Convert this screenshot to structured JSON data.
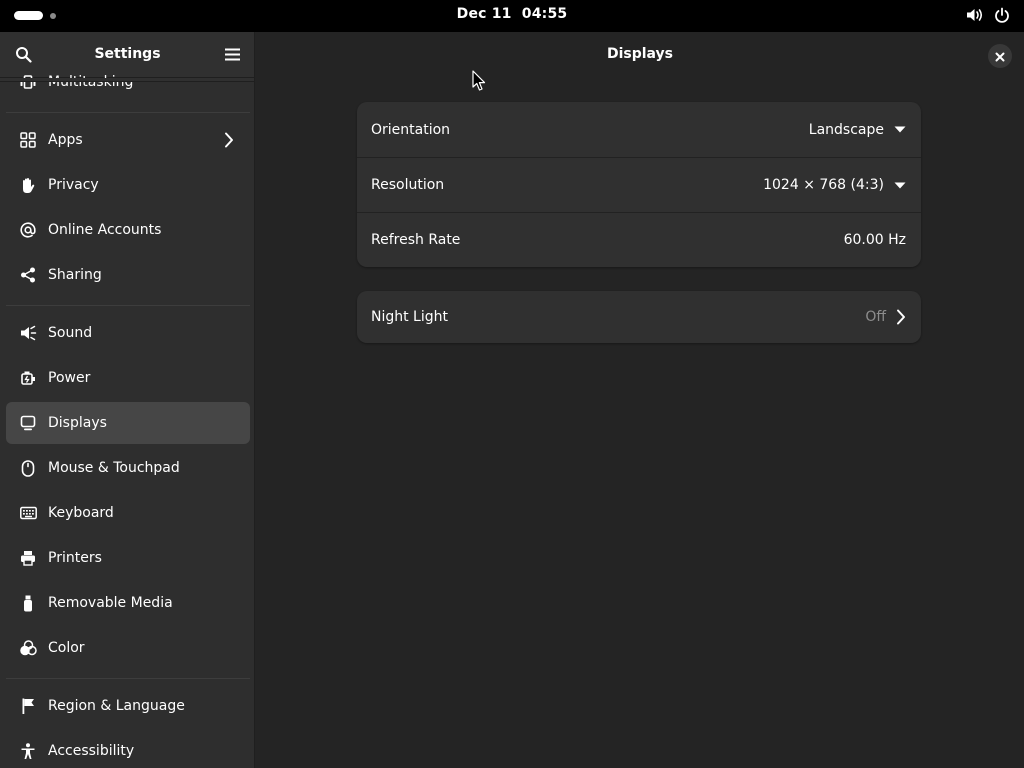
{
  "topbar": {
    "date": "Dec 11",
    "time": "04:55",
    "icons": [
      "activities-indicator",
      "volume-icon",
      "power-icon"
    ]
  },
  "sidebar": {
    "title": "Settings",
    "partial_item": {
      "label": "Multitasking",
      "icon": "multitasking-icon"
    },
    "items": [
      {
        "label": "Apps",
        "icon": "apps-grid-icon",
        "has_chevron": true
      },
      {
        "label": "Privacy",
        "icon": "hand-icon"
      },
      {
        "label": "Online Accounts",
        "icon": "at-sign-icon"
      },
      {
        "label": "Sharing",
        "icon": "share-icon"
      },
      {
        "label": "Sound",
        "icon": "speaker-icon"
      },
      {
        "label": "Power",
        "icon": "power-plug-icon"
      },
      {
        "label": "Displays",
        "icon": "display-icon",
        "selected": true
      },
      {
        "label": "Mouse & Touchpad",
        "icon": "mouse-icon"
      },
      {
        "label": "Keyboard",
        "icon": "keyboard-icon"
      },
      {
        "label": "Printers",
        "icon": "printer-icon"
      },
      {
        "label": "Removable Media",
        "icon": "usb-drive-icon"
      },
      {
        "label": "Color",
        "icon": "color-icon"
      },
      {
        "label": "Region & Language",
        "icon": "flag-icon"
      },
      {
        "label": "Accessibility",
        "icon": "accessibility-icon"
      }
    ]
  },
  "main": {
    "title": "Displays",
    "display_card": {
      "orientation": {
        "label": "Orientation",
        "value": "Landscape"
      },
      "resolution": {
        "label": "Resolution",
        "value": "1024 × 768 (4:3)"
      },
      "refresh_rate": {
        "label": "Refresh Rate",
        "value": "60.00 Hz"
      }
    },
    "night_light": {
      "label": "Night Light",
      "value": "Off"
    }
  },
  "colors": {
    "topbar": "#000000",
    "sidebar": "#2e2e2e",
    "main": "#242424",
    "card": "#303030",
    "selected": "#464646",
    "dim_text": "#8d8d8d"
  }
}
